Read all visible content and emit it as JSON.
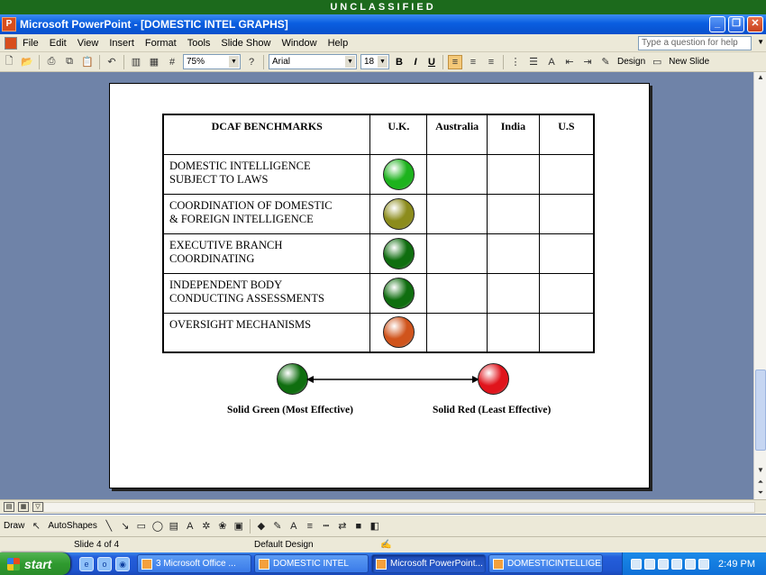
{
  "banner": "UNCLASSIFIED",
  "window": {
    "title": "Microsoft PowerPoint - [DOMESTIC INTEL GRAPHS]"
  },
  "menu": [
    "File",
    "Edit",
    "View",
    "Insert",
    "Format",
    "Tools",
    "Slide Show",
    "Window",
    "Help"
  ],
  "help_placeholder": "Type a question for help",
  "toolbar": {
    "zoom": "75%",
    "font": "Arial",
    "font_size": "18",
    "bold": "B",
    "italic": "I",
    "underline": "U",
    "design_label": "Design",
    "new_slide_label": "New Slide"
  },
  "slide": {
    "table": {
      "headers": [
        "DCAF BENCHMARKS",
        "U.K.",
        "Australia",
        "India",
        "U.S"
      ],
      "rows": [
        {
          "benchmark_line1": "DOMESTIC INTELLIGENCE",
          "benchmark_line2": "SUBJECT TO LAWS",
          "uk_status": "green",
          "uk_color": "#1db31d"
        },
        {
          "benchmark_line1": "COORDINATION OF DOMESTIC",
          "benchmark_line2": "& FOREIGN INTELLIGENCE",
          "uk_status": "olive",
          "uk_color": "#8c8c1c"
        },
        {
          "benchmark_line1": "EXECUTIVE BRANCH",
          "benchmark_line2": "COORDINATING",
          "uk_status": "dark-green",
          "uk_color": "#0f6e0f"
        },
        {
          "benchmark_line1": "INDEPENDENT BODY",
          "benchmark_line2": "CONDUCTING ASSESSMENTS",
          "uk_status": "dark-green",
          "uk_color": "#0f6e0f"
        },
        {
          "benchmark_line1": "OVERSIGHT MECHANISMS",
          "benchmark_line2": "",
          "uk_status": "orange",
          "uk_color": "#d0541c"
        }
      ]
    },
    "legend": {
      "left_label": "Solid Green (Most Effective)",
      "left_color": "#0f6e0f",
      "right_label": "Solid Red (Least Effective)",
      "right_color": "#e0141c"
    }
  },
  "drawbar": {
    "draw_label": "Draw",
    "autoshapes_label": "AutoShapes"
  },
  "status": {
    "slide": "Slide 4 of 4",
    "design": "Default Design"
  },
  "taskbar": {
    "start_label": "start",
    "tasks": [
      {
        "label": "3 Microsoft Office ...",
        "active": false
      },
      {
        "label": "DOMESTIC INTEL",
        "active": false
      },
      {
        "label": "Microsoft PowerPoint...",
        "active": true
      },
      {
        "label": "DOMESTICINTELLIGE...",
        "active": false
      }
    ],
    "clock": "2:49 PM"
  }
}
